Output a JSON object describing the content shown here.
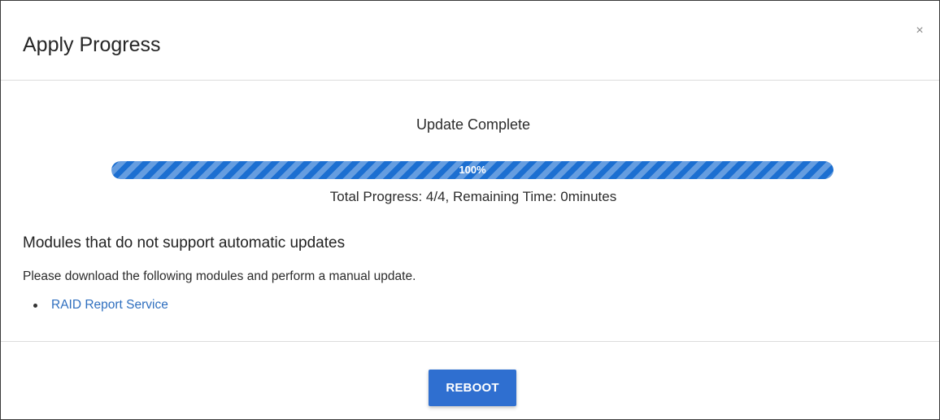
{
  "dialog": {
    "title": "Apply Progress",
    "close_icon": "close-icon",
    "close_glyph": "×"
  },
  "progress": {
    "status": "Update Complete",
    "percent": 100,
    "percent_label": "100%",
    "caption": "Total Progress: 4/4, Remaining Time: 0minutes",
    "bar_color": "#1c6fd1"
  },
  "modules": {
    "heading": "Modules that do not support automatic updates",
    "description": "Please download the following modules and perform a manual update.",
    "items": [
      {
        "label": "RAID Report Service"
      }
    ]
  },
  "footer": {
    "reboot_label": "REBOOT",
    "button_color": "#2f6fd0"
  }
}
